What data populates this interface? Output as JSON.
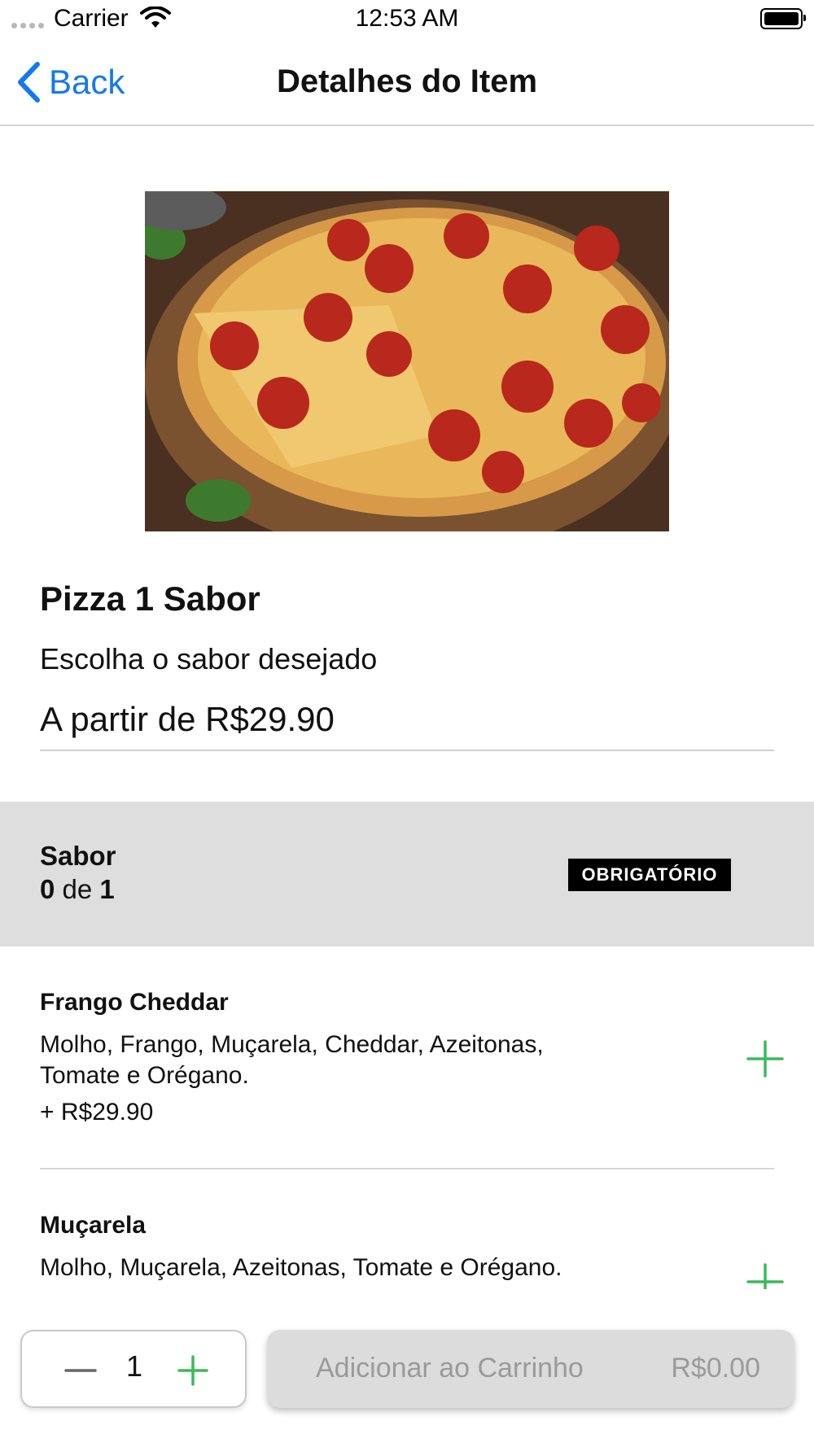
{
  "status_bar": {
    "carrier": "Carrier",
    "time": "12:53 AM"
  },
  "nav": {
    "back_label": "Back",
    "title": "Detalhes do Item"
  },
  "product": {
    "name": "Pizza 1 Sabor",
    "description": "Escolha o sabor desejado",
    "price_text": "A partir de R$29.90"
  },
  "section": {
    "title": "Sabor",
    "selected_count": "0",
    "of_word": "de",
    "max_count": "1",
    "badge": "OBRIGATÓRIO"
  },
  "options": [
    {
      "name": "Frango Cheddar",
      "description": "Molho, Frango, Muçarela, Cheddar, Azeitonas, Tomate e Orégano.",
      "price": "+ R$29.90"
    },
    {
      "name": "Muçarela",
      "description": "Molho, Muçarela, Azeitonas, Tomate e Orégano.",
      "price": ""
    }
  ],
  "footer": {
    "quantity": "1",
    "add_to_cart_label": "Adicionar ao Carrinho",
    "total": "R$0.00"
  },
  "colors": {
    "accent_blue": "#1478f0",
    "add_green": "#3cba5a",
    "section_gray": "#dedede"
  },
  "icons": [
    "wifi-icon",
    "battery-icon",
    "chevron-left-icon",
    "plus-icon",
    "minus-icon"
  ]
}
